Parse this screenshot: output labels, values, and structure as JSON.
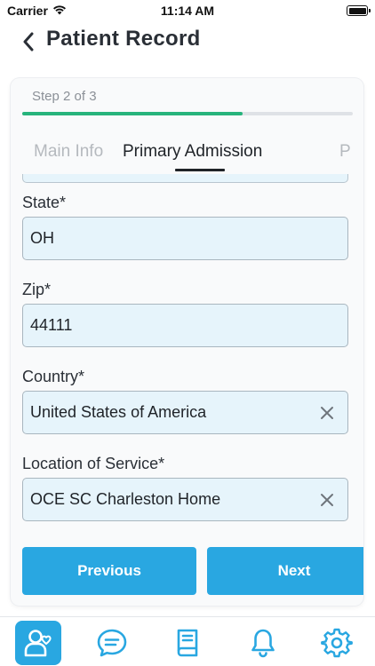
{
  "status_bar": {
    "carrier": "Carrier",
    "time": "11:14 AM"
  },
  "header": {
    "title": "Patient Record"
  },
  "stepper": {
    "label": "Step 2 of 3",
    "progress": 0.667,
    "progress_color": "#27b47c"
  },
  "tabs": [
    {
      "label": "Main Info",
      "active": false
    },
    {
      "label": "Primary Admission",
      "active": true
    },
    {
      "label": "P",
      "active": false
    }
  ],
  "fields": [
    {
      "label": "State*",
      "value": "OH",
      "clearable": false
    },
    {
      "label": "Zip*",
      "value": "44111",
      "clearable": false
    },
    {
      "label": "Country*",
      "value": "United States of America",
      "clearable": true
    },
    {
      "label": "Location of Service*",
      "value": "OCE SC Charleston Home",
      "clearable": true
    }
  ],
  "actions": {
    "previous_label": "Previous",
    "next_label": "Next"
  },
  "bottom_nav": {
    "items": [
      {
        "icon": "patients-icon",
        "selected": true
      },
      {
        "icon": "chat-icon",
        "selected": false
      },
      {
        "icon": "book-icon",
        "selected": false
      },
      {
        "icon": "bell-icon",
        "selected": false
      },
      {
        "icon": "gear-icon",
        "selected": false
      }
    ],
    "accent_color": "#29a7e1"
  }
}
